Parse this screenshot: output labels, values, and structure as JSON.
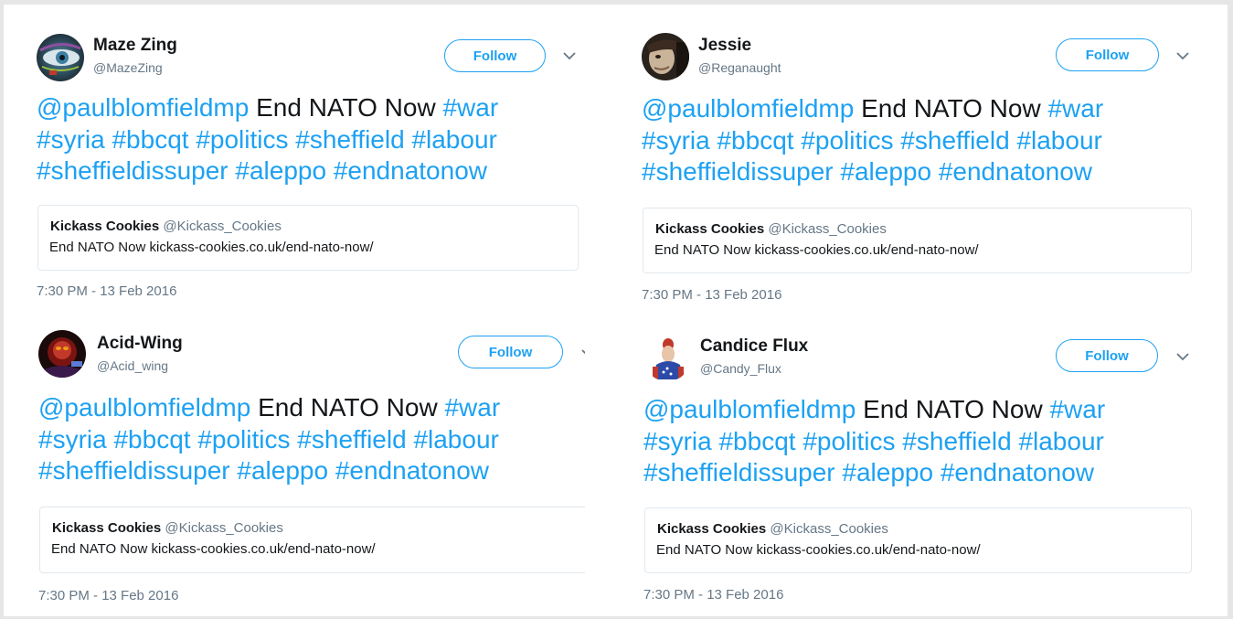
{
  "tweets": [
    {
      "display_name": "Maze Zing",
      "handle": "@MazeZing",
      "follow_label": "Follow",
      "text_line1": [
        {
          "text": "@paulblomfieldmp",
          "link": true
        },
        {
          "text": " End NATO Now ",
          "link": false
        },
        {
          "text": "#war",
          "link": true
        }
      ],
      "text_line2": [
        {
          "text": "#syria",
          "link": true
        },
        {
          "text": " ",
          "link": false
        },
        {
          "text": "#bbcqt",
          "link": true
        },
        {
          "text": " ",
          "link": false
        },
        {
          "text": "#politics",
          "link": true
        },
        {
          "text": " ",
          "link": false
        },
        {
          "text": "#sheffield",
          "link": true
        },
        {
          "text": " ",
          "link": false
        },
        {
          "text": "#labour",
          "link": true
        }
      ],
      "text_line3": [
        {
          "text": "#sheffieldissuper",
          "link": true
        },
        {
          "text": " ",
          "link": false
        },
        {
          "text": "#aleppo",
          "link": true
        },
        {
          "text": " ",
          "link": false
        },
        {
          "text": "#endnatonow",
          "link": true
        }
      ],
      "quote": {
        "name": "Kickass Cookies",
        "handle": "@Kickass_Cookies",
        "text": "End NATO Now kickass-cookies.co.uk/end-nato-now/"
      },
      "timestamp": "7:30 PM - 13 Feb 2016"
    },
    {
      "display_name": "Jessie",
      "handle": "@Reganaught",
      "follow_label": "Follow",
      "text_line1": [
        {
          "text": "@paulblomfieldmp",
          "link": true
        },
        {
          "text": " End NATO Now ",
          "link": false
        },
        {
          "text": "#war",
          "link": true
        }
      ],
      "text_line2": [
        {
          "text": "#syria",
          "link": true
        },
        {
          "text": " ",
          "link": false
        },
        {
          "text": "#bbcqt",
          "link": true
        },
        {
          "text": " ",
          "link": false
        },
        {
          "text": "#politics",
          "link": true
        },
        {
          "text": " ",
          "link": false
        },
        {
          "text": "#sheffield",
          "link": true
        },
        {
          "text": " ",
          "link": false
        },
        {
          "text": "#labour",
          "link": true
        }
      ],
      "text_line3": [
        {
          "text": "#sheffieldissuper",
          "link": true
        },
        {
          "text": " ",
          "link": false
        },
        {
          "text": "#aleppo",
          "link": true
        },
        {
          "text": " ",
          "link": false
        },
        {
          "text": "#endnatonow",
          "link": true
        }
      ],
      "quote": {
        "name": "Kickass Cookies",
        "handle": "@Kickass_Cookies",
        "text": "End NATO Now kickass-cookies.co.uk/end-nato-now/"
      },
      "timestamp": "7:30 PM - 13 Feb 2016"
    },
    {
      "display_name": "Acid-Wing",
      "handle": "@Acid_wing",
      "follow_label": "Follow",
      "text_line1": [
        {
          "text": "@paulblomfieldmp",
          "link": true
        },
        {
          "text": " End NATO Now ",
          "link": false
        },
        {
          "text": "#war",
          "link": true
        }
      ],
      "text_line2": [
        {
          "text": "#syria",
          "link": true
        },
        {
          "text": " ",
          "link": false
        },
        {
          "text": "#bbcqt",
          "link": true
        },
        {
          "text": " ",
          "link": false
        },
        {
          "text": "#politics",
          "link": true
        },
        {
          "text": " ",
          "link": false
        },
        {
          "text": "#sheffield",
          "link": true
        },
        {
          "text": " ",
          "link": false
        },
        {
          "text": "#labour",
          "link": true
        }
      ],
      "text_line3": [
        {
          "text": "#sheffieldissuper",
          "link": true
        },
        {
          "text": " ",
          "link": false
        },
        {
          "text": "#aleppo",
          "link": true
        },
        {
          "text": " ",
          "link": false
        },
        {
          "text": "#endnatonow",
          "link": true
        }
      ],
      "quote": {
        "name": "Kickass Cookies",
        "handle": "@Kickass_Cookies",
        "text": "End NATO Now kickass-cookies.co.uk/end-nato-now/"
      },
      "timestamp": "7:30 PM - 13 Feb 2016"
    },
    {
      "display_name": "Candice Flux",
      "handle": "@Candy_Flux",
      "follow_label": "Follow",
      "text_line1": [
        {
          "text": "@paulblomfieldmp",
          "link": true
        },
        {
          "text": " End NATO Now ",
          "link": false
        },
        {
          "text": "#war",
          "link": true
        }
      ],
      "text_line2": [
        {
          "text": "#syria",
          "link": true
        },
        {
          "text": " ",
          "link": false
        },
        {
          "text": "#bbcqt",
          "link": true
        },
        {
          "text": " ",
          "link": false
        },
        {
          "text": "#politics",
          "link": true
        },
        {
          "text": " ",
          "link": false
        },
        {
          "text": "#sheffield",
          "link": true
        },
        {
          "text": " ",
          "link": false
        },
        {
          "text": "#labour",
          "link": true
        }
      ],
      "text_line3": [
        {
          "text": "#sheffieldissuper",
          "link": true
        },
        {
          "text": " ",
          "link": false
        },
        {
          "text": "#aleppo",
          "link": true
        },
        {
          "text": " ",
          "link": false
        },
        {
          "text": "#endnatonow",
          "link": true
        }
      ],
      "quote": {
        "name": "Kickass Cookies",
        "handle": "@Kickass_Cookies",
        "text": "End NATO Now kickass-cookies.co.uk/end-nato-now/"
      },
      "timestamp": "7:30 PM - 13 Feb 2016"
    }
  ],
  "icons": {
    "menu": "chevron-down-icon",
    "avatar": "avatar-icon"
  },
  "colors": {
    "link": "#1da1f2",
    "text": "#14171a",
    "muted": "#657786",
    "border": "#e1e8ed",
    "background": "#e6e6e6"
  }
}
